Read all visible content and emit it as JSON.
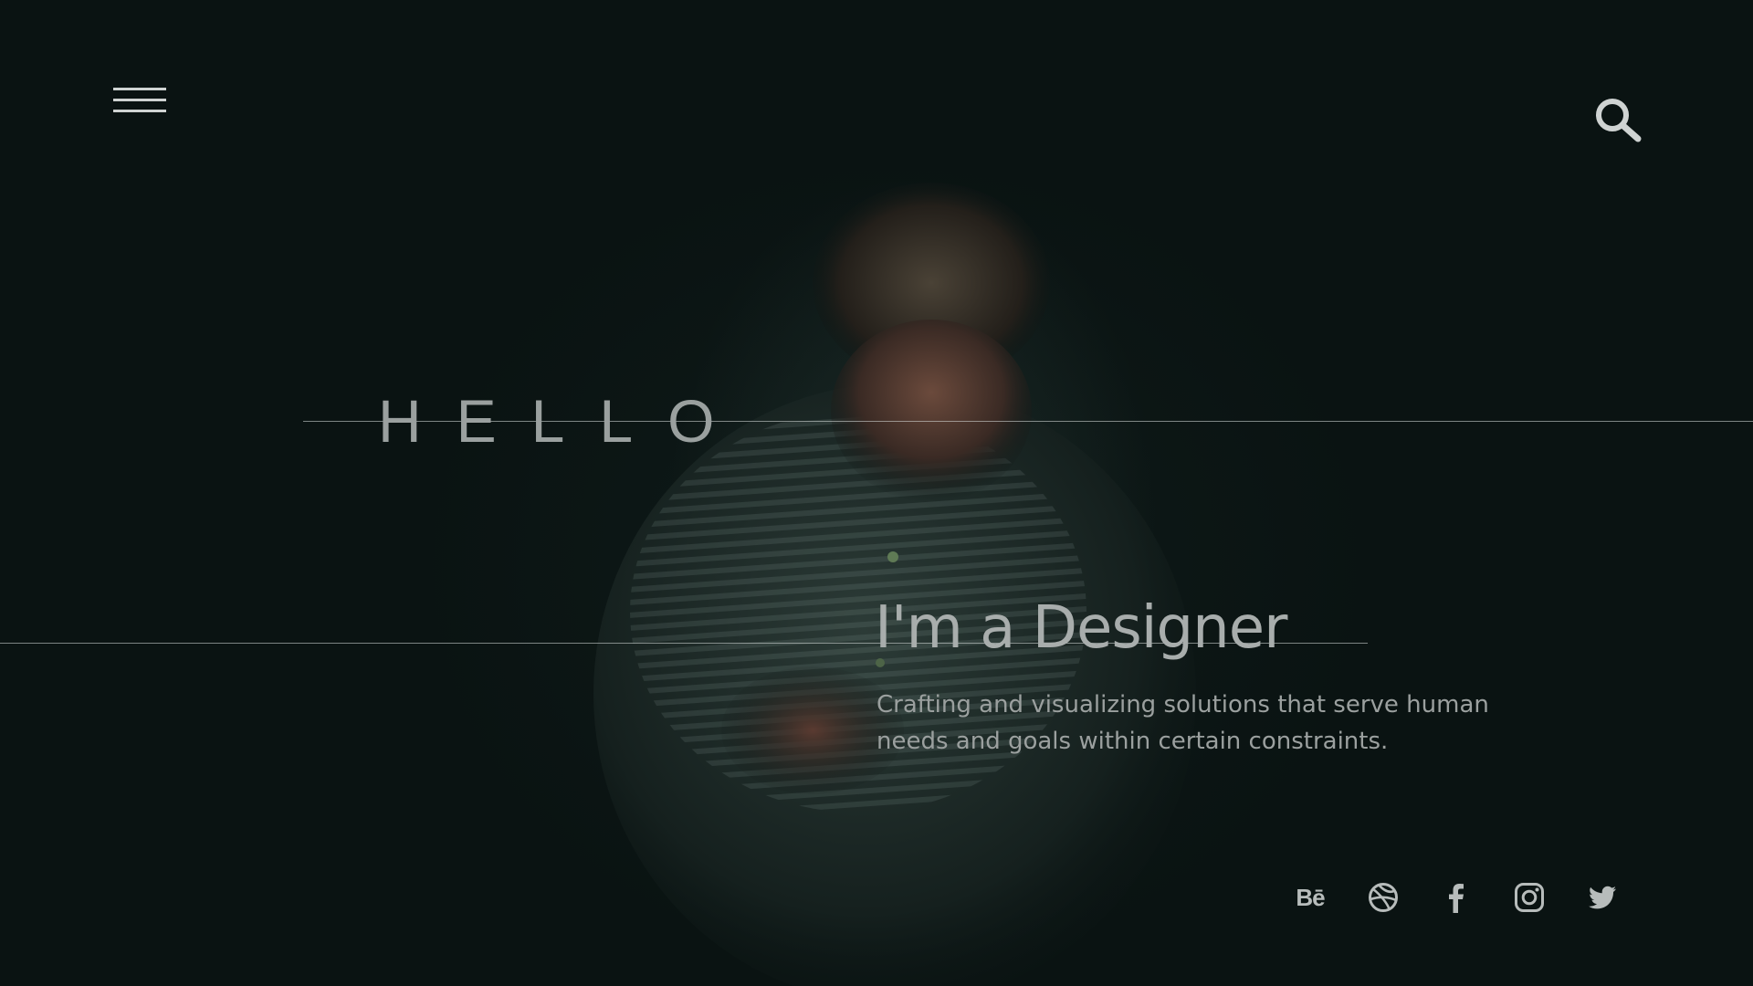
{
  "header": {
    "menu_icon": "hamburger-menu-icon",
    "search_icon": "search-icon"
  },
  "hero": {
    "greeting": "HELLO",
    "headline": "I'm a Designer",
    "subtitle": "Crafting and visualizing solutions that serve human needs and goals within certain constraints.",
    "image": "dark portrait of a man in a striped shirt looking down"
  },
  "socials": [
    {
      "name": "behance",
      "icon": "behance-icon",
      "label": "Bē"
    },
    {
      "name": "dribbble",
      "icon": "dribbble-icon"
    },
    {
      "name": "facebook",
      "icon": "facebook-icon"
    },
    {
      "name": "instagram",
      "icon": "instagram-icon"
    },
    {
      "name": "twitter",
      "icon": "twitter-icon"
    }
  ],
  "colors": {
    "background": "#0a1312",
    "text": "#a8adac",
    "line": "#dce1e0",
    "icon": "#b7bcbb"
  }
}
